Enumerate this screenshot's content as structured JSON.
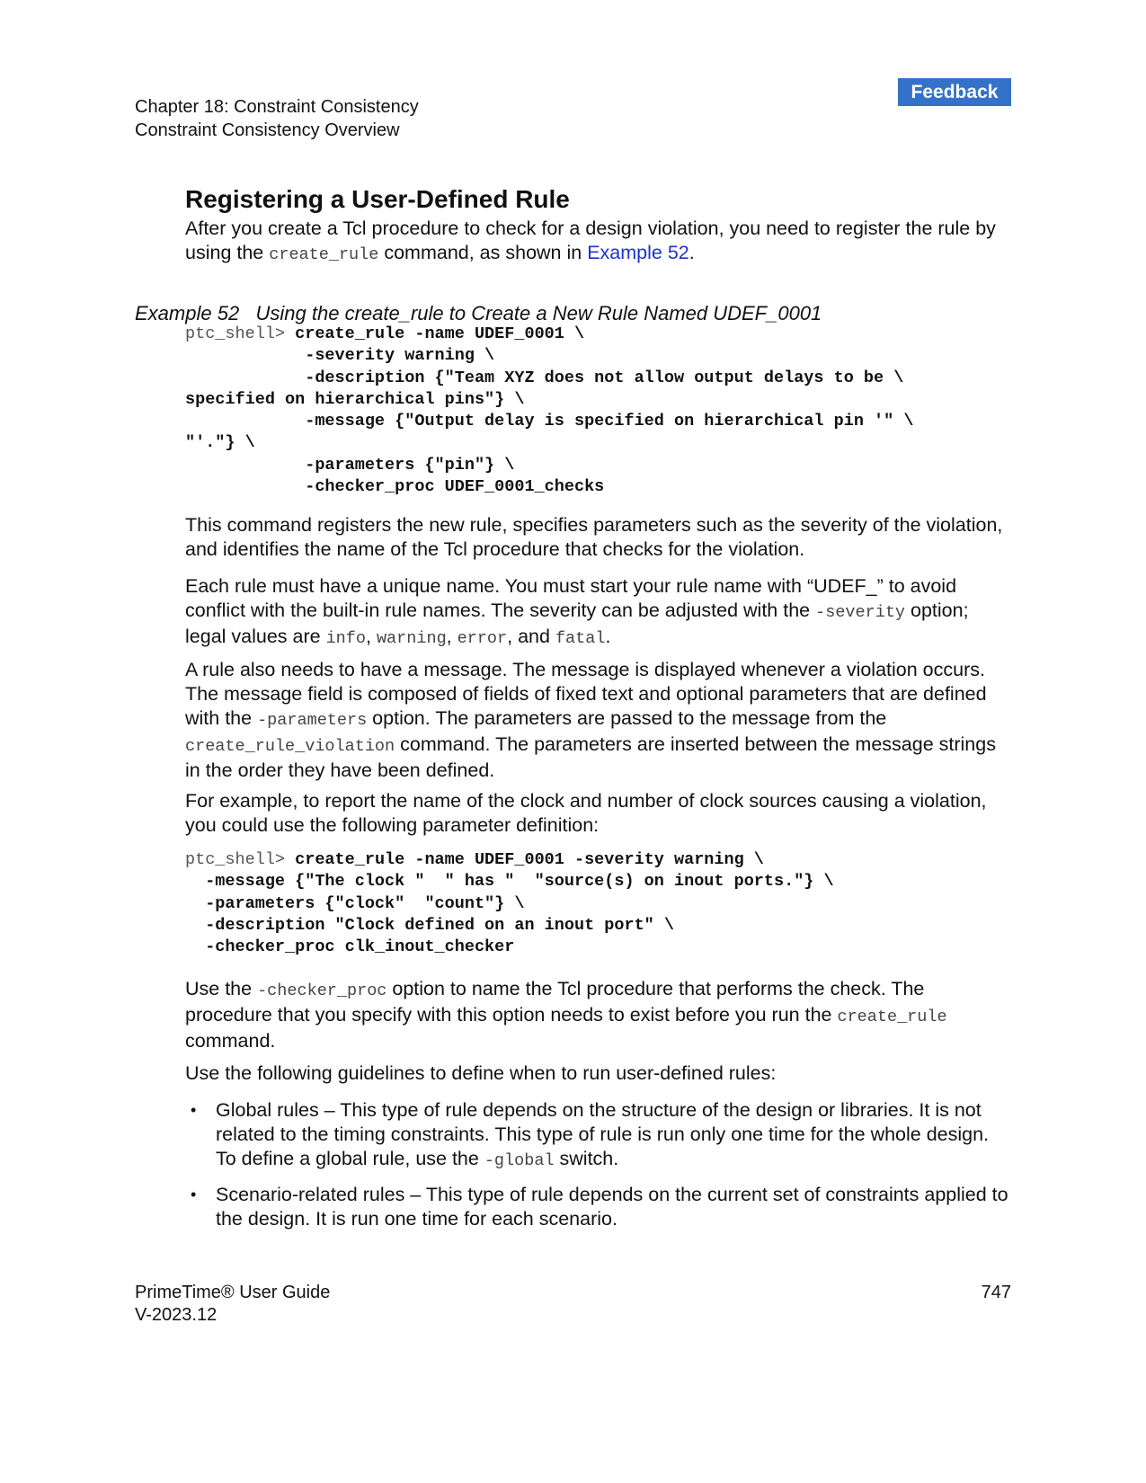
{
  "header": {
    "chapter": "Chapter 18: Constraint Consistency",
    "section": "Constraint Consistency Overview",
    "feedback_label": "Feedback"
  },
  "title": "Registering a User-Defined Rule",
  "intro": {
    "t1": "After you create a Tcl procedure to check for a design violation, you need to register the rule by using the ",
    "code1": "create_rule",
    "t2": " command, as shown in ",
    "link": "Example 52",
    "t3": "."
  },
  "example": {
    "label": "Example 52",
    "title": "Using the create_rule to Create a New Rule Named UDEF_0001"
  },
  "code1": {
    "prompt": "ptc_shell> ",
    "lines": [
      "create_rule -name UDEF_0001 \\",
      "            -severity warning \\",
      "            -description {\"Team XYZ does not allow output delays to be \\",
      "specified on hierarchical pins\"} \\",
      "            -message {\"Output delay is specified on hierarchical pin '\" \\",
      "\"'.\"} \\",
      "            -parameters {\"pin\"} \\",
      "            -checker_proc UDEF_0001_checks"
    ]
  },
  "p1": "This command registers the new rule, specifies parameters such as the severity of the violation, and identifies the name of the Tcl procedure that checks for the violation.",
  "p2": {
    "t1": "Each rule must have a unique name. You must start your rule name with “UDEF_” to avoid conflict with the built-in rule names. The severity can be adjusted with the ",
    "c1": "-severity",
    "t2": " option; legal values are ",
    "c2": "info",
    "s1": ", ",
    "c3": "warning",
    "s2": ", ",
    "c4": "error",
    "s3": ", and ",
    "c5": "fatal",
    "t3": "."
  },
  "p3": {
    "t1": "A rule also needs to have a message. The message is displayed whenever a violation occurs. The message field is composed of fields of fixed text and optional parameters that are defined with the ",
    "c1": "-parameters",
    "t2": " option. The parameters are passed to the message from the ",
    "c2": "create_rule_violation",
    "t3": " command. The parameters are inserted between the message strings in the order they have been defined."
  },
  "p4": "For example, to report the name of the clock and number of clock sources causing a violation, you could use the following parameter definition:",
  "code2": {
    "prompt": "ptc_shell> ",
    "lines": [
      "create_rule -name UDEF_0001 -severity warning \\",
      "  -message {\"The clock \"  \" has \"  \"source(s) on inout ports.\"} \\",
      "  -parameters {\"clock\"  \"count\"} \\",
      "  -description \"Clock defined on an inout port\" \\",
      "  -checker_proc clk_inout_checker"
    ]
  },
  "p5": {
    "t1": "Use the ",
    "c1": "-checker_proc",
    "t2": " option to name the Tcl procedure that performs the check. The procedure that you specify with this option needs to exist before you run the ",
    "c2": "create_rule",
    "t3": " command."
  },
  "p6": "Use the following guidelines to define when to run user-defined rules:",
  "bullets": [
    {
      "t1": "Global rules – This type of rule depends on the structure of the design or libraries. It is not related to the timing constraints. This type of rule is run only one time for the whole design. To define a global rule, use the ",
      "code": "-global",
      "t2": " switch."
    },
    {
      "t1": "Scenario-related rules – This type of rule depends on the current set of constraints applied to the design. It is run one time for each scenario."
    }
  ],
  "bullet_symbol": "•",
  "footer": {
    "guide": "PrimeTime® User Guide",
    "version": "V-2023.12",
    "page": "747"
  }
}
